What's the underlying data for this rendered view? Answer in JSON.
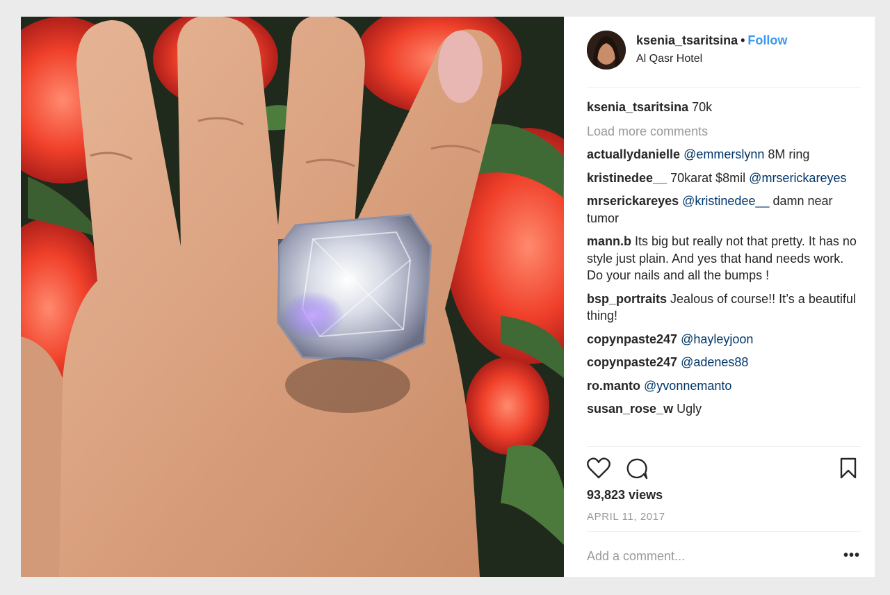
{
  "post": {
    "username": "ksenia_tsaritsina",
    "separator": "•",
    "follow_label": "Follow",
    "location": "Al Qasr Hotel",
    "caption": {
      "user": "ksenia_tsaritsina",
      "text": "70k"
    },
    "load_more_label": "Load more comments",
    "comments": [
      {
        "user": "actuallydanielle",
        "mention": "@emmerslynn",
        "text": "8M ring"
      },
      {
        "user": "kristinedee__",
        "text": "70karat $8mil",
        "mention": "@mrserickareyes"
      },
      {
        "user": "mrserickareyes",
        "mention": "@kristinedee__",
        "text": "damn near tumor"
      },
      {
        "user": "mann.b",
        "text": "Its big but really not that pretty. It has no style just plain. And yes that hand needs work. Do your nails and all the bumps !"
      },
      {
        "user": "bsp_portraits",
        "text": "Jealous of course!! It’s a beautiful thing!"
      },
      {
        "user": "copynpaste247",
        "mention": "@hayleyjoon"
      },
      {
        "user": "copynpaste247",
        "mention": "@adenes88"
      },
      {
        "user": "ro.manto",
        "mention": "@yvonnemanto"
      },
      {
        "user": "susan_rose_w",
        "text": "Ugly"
      }
    ],
    "views": "93,823 views",
    "date": "APRIL 11, 2017",
    "add_comment_placeholder": "Add a comment...",
    "more_options": "•••"
  },
  "icons": {
    "like": "heart-icon",
    "comment": "comment-bubble-icon",
    "save": "bookmark-icon",
    "more": "more-options-icon"
  },
  "colors": {
    "link_blue": "#3897f0",
    "mention": "#003569",
    "muted": "#999999",
    "text": "#262626"
  }
}
